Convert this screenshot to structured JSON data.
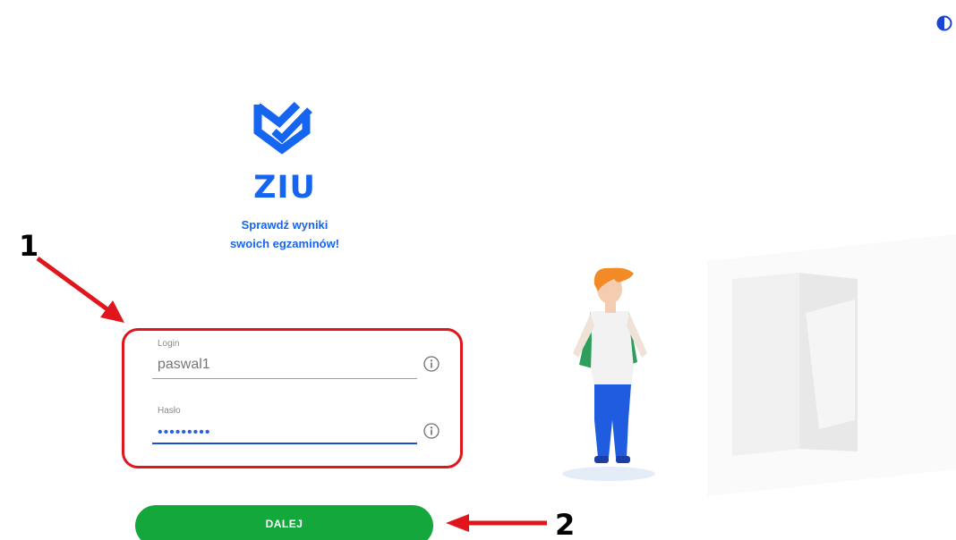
{
  "brand": {
    "name": "ZIU",
    "tagline_line1": "Sprawdź wyniki",
    "tagline_line2": "swoich egzaminów!",
    "color": "#1565f0"
  },
  "form": {
    "login_label": "Login",
    "login_value": "paswal1",
    "password_label": "Hasło",
    "password_value": "•••••••••"
  },
  "buttons": {
    "submit_label": "DALEJ",
    "submit_color": "#14a83c"
  },
  "annotations": {
    "marker_1": "1",
    "marker_2": "2",
    "color": "#e0161c"
  },
  "icons": {
    "contrast": "contrast-icon",
    "info": "info-icon",
    "logo": "ziu-logo-icon"
  }
}
